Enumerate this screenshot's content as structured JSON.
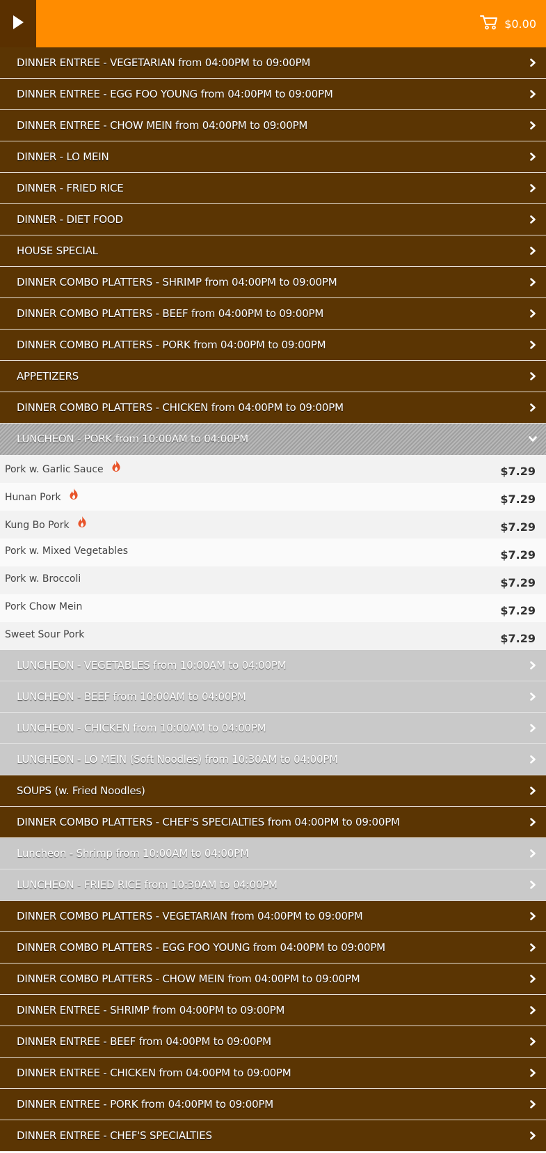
{
  "header": {
    "cart_total": "$0.00",
    "menu_icon": "play-icon",
    "cart_icon": "shopping-cart-icon"
  },
  "colors": {
    "header_bg": "#ff8c00",
    "toggle_bg": "#5a3000",
    "category_dark_bg": "#5b3503",
    "category_light_bg": "#c9c9c9",
    "spicy_icon": "#e8542a"
  },
  "categories_top": [
    {
      "label": "DINNER ENTREE - VEGETARIAN from 04:00PM to 09:00PM"
    },
    {
      "label": "DINNER ENTREE - EGG FOO YOUNG from 04:00PM to 09:00PM"
    },
    {
      "label": "DINNER ENTREE - CHOW MEIN from 04:00PM to 09:00PM"
    },
    {
      "label": "DINNER - LO MEIN"
    },
    {
      "label": "DINNER - FRIED RICE"
    },
    {
      "label": "DINNER - DIET FOOD"
    },
    {
      "label": "HOUSE SPECIAL"
    },
    {
      "label": "DINNER COMBO PLATTERS - SHRIMP from 04:00PM to 09:00PM"
    },
    {
      "label": "DINNER COMBO PLATTERS - BEEF from 04:00PM to 09:00PM"
    },
    {
      "label": "DINNER COMBO PLATTERS - PORK from 04:00PM to 09:00PM"
    },
    {
      "label": "APPETIZERS"
    },
    {
      "label": "DINNER COMBO PLATTERS - CHICKEN from 04:00PM to 09:00PM"
    }
  ],
  "open_category": {
    "label": "LUNCHEON - PORK from 10:00AM to 04:00PM",
    "items": [
      {
        "name": "Pork w. Garlic Sauce",
        "price": "$7.29",
        "spicy": true
      },
      {
        "name": "Hunan Pork",
        "price": "$7.29",
        "spicy": true
      },
      {
        "name": "Kung Bo Pork",
        "price": "$7.29",
        "spicy": true
      },
      {
        "name": "Pork w. Mixed Vegetables",
        "price": "$7.29",
        "spicy": false
      },
      {
        "name": "Pork w. Broccoli",
        "price": "$7.29",
        "spicy": false
      },
      {
        "name": "Pork Chow Mein",
        "price": "$7.29",
        "spicy": false
      },
      {
        "name": "Sweet Sour Pork",
        "price": "$7.29",
        "spicy": false
      }
    ]
  },
  "categories_bottom": [
    {
      "label": "LUNCHEON - VEGETABLES from 10:00AM to 04:00PM",
      "style": "light"
    },
    {
      "label": "LUNCHEON - BEEF from 10:00AM to 04:00PM",
      "style": "light"
    },
    {
      "label": "LUNCHEON - CHICKEN from 10:00AM to 04:00PM",
      "style": "light"
    },
    {
      "label": "LUNCHEON - LO MEIN (Soft Noodles) from 10:30AM to 04:00PM",
      "style": "light"
    },
    {
      "label": "SOUPS (w. Fried Noodles)",
      "style": "dark"
    },
    {
      "label": "DINNER COMBO PLATTERS - CHEF'S SPECIALTIES from 04:00PM to 09:00PM",
      "style": "dark"
    },
    {
      "label": "Luncheon - Shrimp from 10:00AM to 04:00PM",
      "style": "light"
    },
    {
      "label": "LUNCHEON - FRIED RICE from 10:30AM to 04:00PM",
      "style": "light"
    },
    {
      "label": "DINNER COMBO PLATTERS - VEGETARIAN from 04:00PM to 09:00PM",
      "style": "dark"
    },
    {
      "label": "DINNER COMBO PLATTERS - EGG FOO YOUNG from 04:00PM to 09:00PM",
      "style": "dark"
    },
    {
      "label": "DINNER COMBO PLATTERS - CHOW MEIN from 04:00PM to 09:00PM",
      "style": "dark"
    },
    {
      "label": "DINNER ENTREE - SHRIMP from 04:00PM to 09:00PM",
      "style": "dark"
    },
    {
      "label": "DINNER ENTREE - BEEF from 04:00PM to 09:00PM",
      "style": "dark"
    },
    {
      "label": "DINNER ENTREE - CHICKEN from 04:00PM to 09:00PM",
      "style": "dark"
    },
    {
      "label": "DINNER ENTREE - PORK from 04:00PM to 09:00PM",
      "style": "dark"
    },
    {
      "label": "DINNER ENTREE - CHEF'S SPECIALTIES",
      "style": "dark"
    }
  ]
}
